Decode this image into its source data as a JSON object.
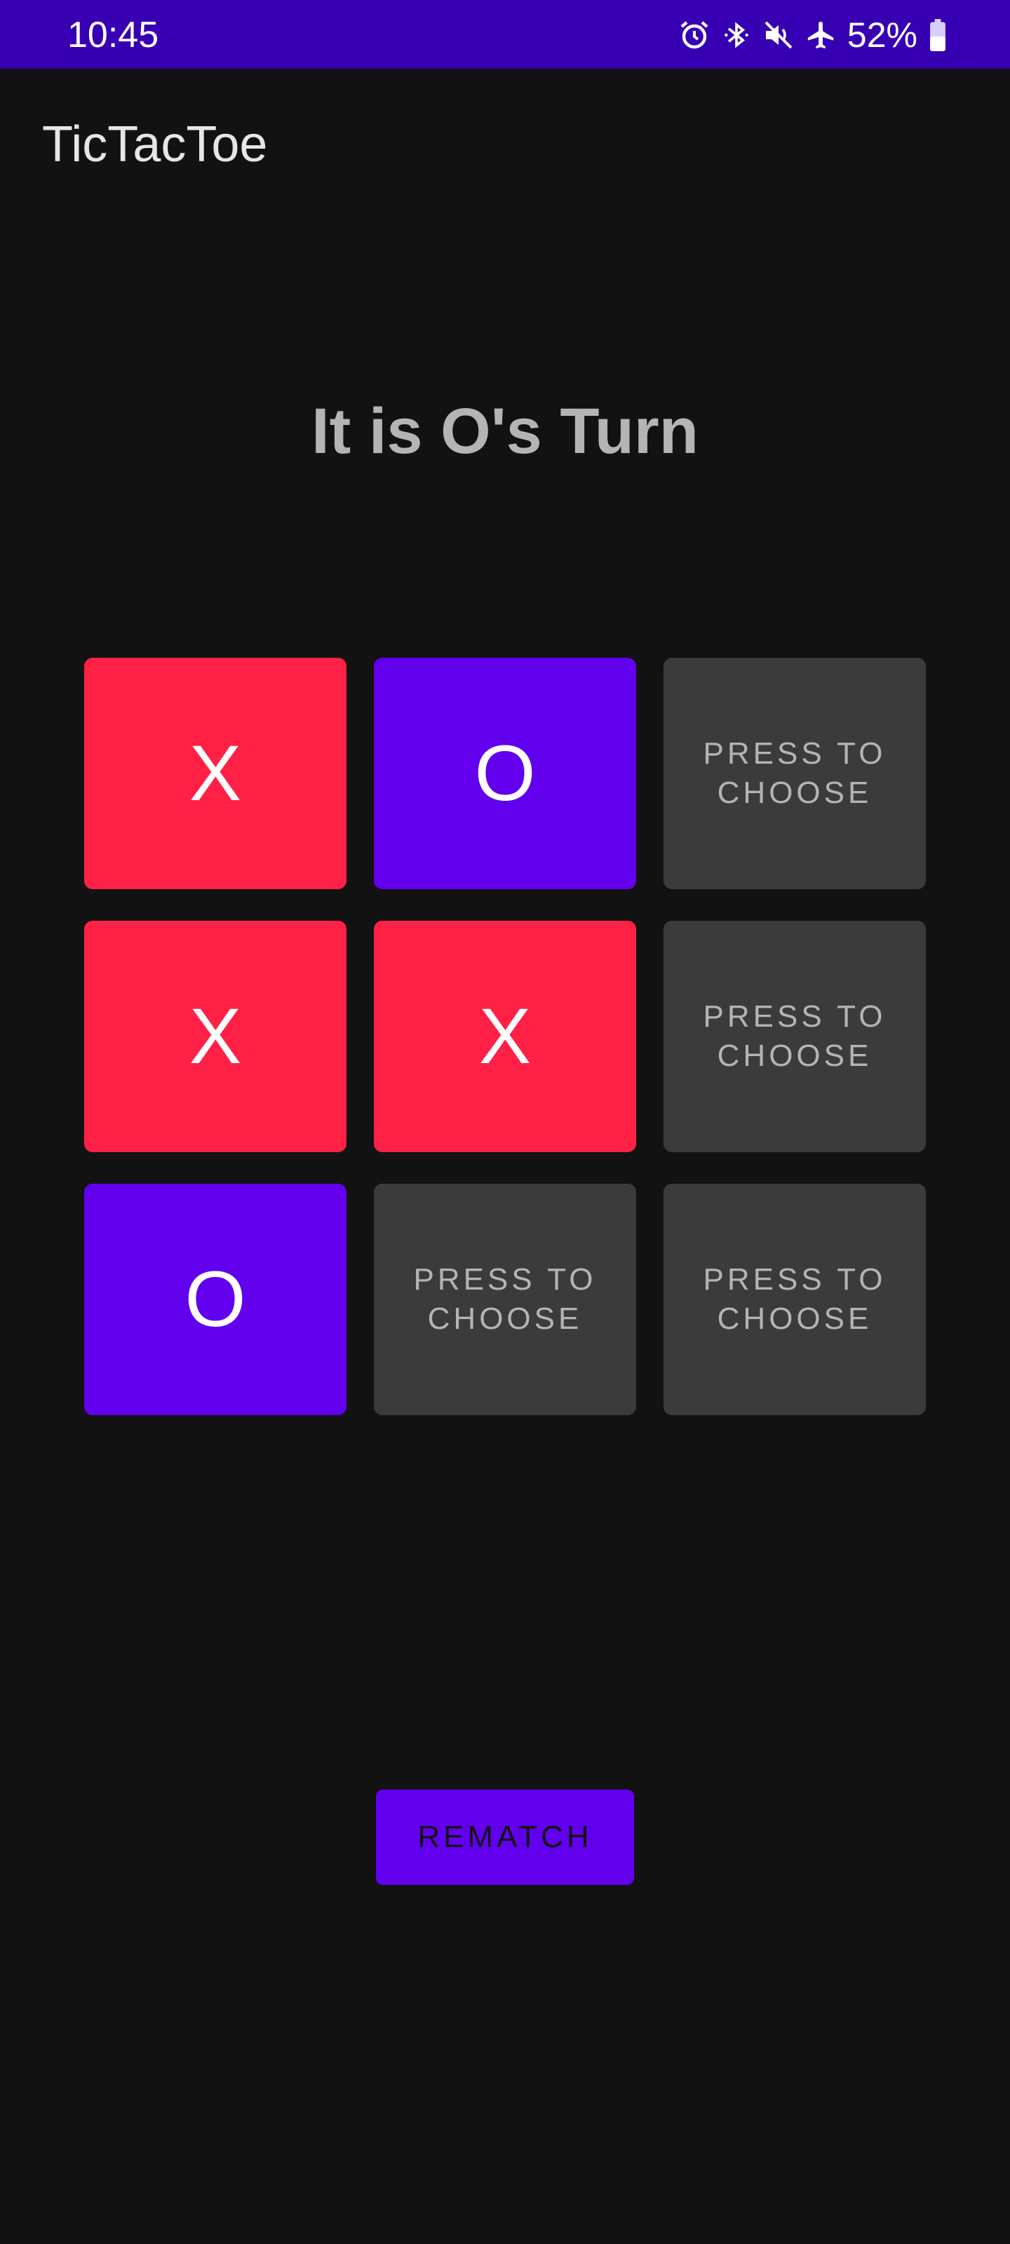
{
  "status_bar": {
    "time": "10:45",
    "battery": "52%",
    "icons": [
      "alarm-icon",
      "bluetooth-icon",
      "mute-icon",
      "airplane-mode-icon",
      "battery-icon"
    ]
  },
  "app": {
    "title": "TicTacToe"
  },
  "game": {
    "turn_text": "It is O's Turn",
    "cells": [
      {
        "state": "x",
        "label": "X"
      },
      {
        "state": "o",
        "label": "O"
      },
      {
        "state": "empty",
        "label": "PRESS TO CHOOSE"
      },
      {
        "state": "x",
        "label": "X"
      },
      {
        "state": "x",
        "label": "X"
      },
      {
        "state": "empty",
        "label": "PRESS TO CHOOSE"
      },
      {
        "state": "o",
        "label": "O"
      },
      {
        "state": "empty",
        "label": "PRESS TO CHOOSE"
      },
      {
        "state": "empty",
        "label": "PRESS TO CHOOSE"
      }
    ],
    "rematch_label": "REMATCH"
  },
  "colors": {
    "status_bar": "#3700B3",
    "background": "#121212",
    "x_cell": "#FF2046",
    "o_cell": "#6200EE",
    "empty_cell": "#3B3B3B",
    "accent": "#6200EE"
  }
}
